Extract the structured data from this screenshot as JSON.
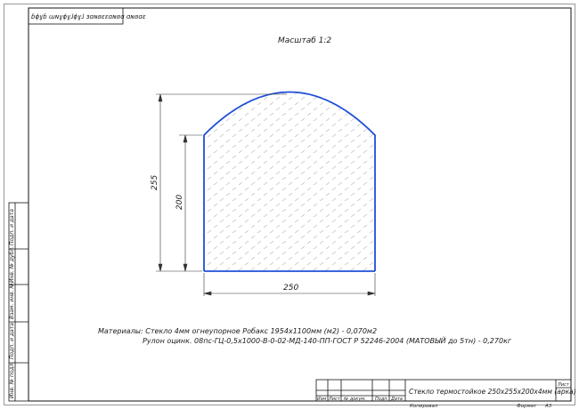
{
  "drawing": {
    "top_stamp": "ɓɸɣɓ ɯɴɣɸɣɺɸɣɺ ɜɑɴɞɛɛɑɴɞɑ ɑɴɞɑɛ",
    "scale": "Масштаб 1:2"
  },
  "part": {
    "width_dim": "250",
    "overall_height_dim": "255",
    "side_height_dim": "200",
    "outline_color": "#1f4fd8"
  },
  "notes": {
    "line1": "Материалы: Стекло 4мм огнеупорное Робакс 1954х1100мм (м2) - 0,070м2",
    "line2": "Рулон оцинк. 08пс-ГЦ-0,5х1000-В-0-02-МД-140-ПП-ГОСТ Р 52246-2004 (МАТОВЫЙ до 5тн) - 0,270кг"
  },
  "side_stamp": {
    "labels": [
      "Инв. № подл.",
      "Подп. и дата",
      "Взам. инв. №",
      "Инв. № дубл.",
      "Подп. и дата"
    ]
  },
  "title_block": {
    "headers": [
      "Изм",
      "Лист",
      "№ докум.",
      "Подп.",
      "Дата"
    ],
    "name": "Стекло термостойкое 250х255х200х4мм (арка)",
    "sheet_label": "Лист",
    "copied": "Копировал",
    "format_label": "Формат",
    "format_value": "А3"
  }
}
